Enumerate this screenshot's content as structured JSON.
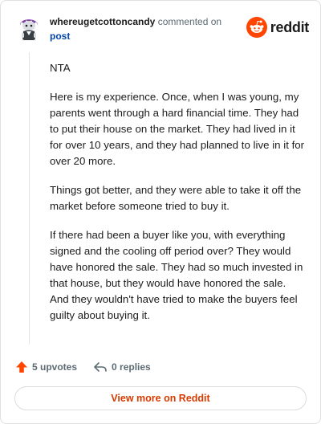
{
  "comment": {
    "username": "whereugetcottoncandy",
    "action_text": "commented on",
    "post_link_label": "post",
    "paragraphs": [
      "NTA",
      "Here is my experience. Once, when I was young, my parents went through a hard financial time. They had to put their house on the market. They had lived in it for over 10 years, and they had planned to live in it for over 20 more.",
      "Things got better, and they were able to take it off the market before someone tried to buy it.",
      "If there had been a buyer like you, with everything signed and the cooling off period over? They would have honored the sale. They had so much invested in that house, but they would have honored the sale. And they wouldn't have tried to make the buyers feel guilty about buying it."
    ]
  },
  "brand": {
    "name": "reddit",
    "color": "#ff4500"
  },
  "stats": {
    "upvotes_label": "5 upvotes",
    "replies_label": "0 replies",
    "upvote_color": "#ff4500"
  },
  "footer": {
    "view_more_label": "View more on Reddit",
    "accent_color": "#d93a00"
  }
}
